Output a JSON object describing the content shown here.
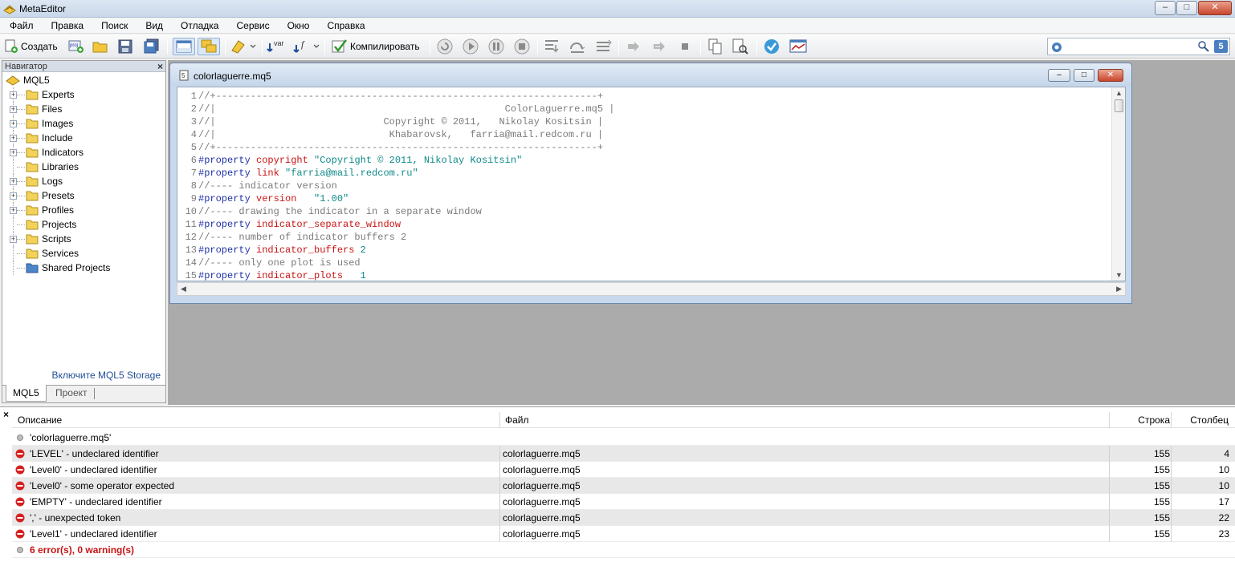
{
  "window": {
    "title": "MetaEditor",
    "min_icon": "minimize-icon",
    "max_icon": "maximize-icon",
    "close_icon": "close-icon"
  },
  "menu": [
    "Файл",
    "Правка",
    "Поиск",
    "Вид",
    "Отладка",
    "Сервис",
    "Окно",
    "Справка"
  ],
  "toolbar": {
    "create_label": "Создать",
    "compile_label": "Компилировать",
    "var_label": "var",
    "func_label": "f",
    "search_placeholder": "",
    "search_badge": "5"
  },
  "navigator": {
    "header": "Навигатор",
    "root": "MQL5",
    "items": [
      {
        "label": "Experts",
        "expandable": true
      },
      {
        "label": "Files",
        "expandable": true
      },
      {
        "label": "Images",
        "expandable": true
      },
      {
        "label": "Include",
        "expandable": true
      },
      {
        "label": "Indicators",
        "expandable": true
      },
      {
        "label": "Libraries",
        "expandable": false
      },
      {
        "label": "Logs",
        "expandable": true
      },
      {
        "label": "Presets",
        "expandable": true
      },
      {
        "label": "Profiles",
        "expandable": true
      },
      {
        "label": "Projects",
        "expandable": false
      },
      {
        "label": "Scripts",
        "expandable": true
      },
      {
        "label": "Services",
        "expandable": false
      },
      {
        "label": "Shared Projects",
        "expandable": false
      }
    ],
    "storage_link": "Включите MQL5 Storage",
    "tabs": [
      "MQL5",
      "Проект"
    ]
  },
  "editor": {
    "file_title": "colorlaguerre.mq5",
    "lines": [
      [
        [
          "c-cm",
          "//+------------------------------------------------------------------+"
        ]
      ],
      [
        [
          "c-cm",
          "//|                                                  ColorLaguerre.mq5 |"
        ]
      ],
      [
        [
          "c-cm",
          "//|                             Copyright © 2011,   Nikolay Kositsin |"
        ]
      ],
      [
        [
          "c-cm",
          "//|                              Khabarovsk,   farria@mail.redcom.ru |"
        ]
      ],
      [
        [
          "c-cm",
          "//+------------------------------------------------------------------+"
        ]
      ],
      [
        [
          "c-pp",
          "#property "
        ],
        [
          "c-kw",
          "copyright "
        ],
        [
          "c-str",
          "\"Copyright © 2011, Nikolay Kositsin\""
        ]
      ],
      [
        [
          "c-pp",
          "#property "
        ],
        [
          "c-kw",
          "link "
        ],
        [
          "c-str",
          "\"farria@mail.redcom.ru\""
        ]
      ],
      [
        [
          "c-cm",
          "//---- indicator version"
        ]
      ],
      [
        [
          "c-pp",
          "#property "
        ],
        [
          "c-kw",
          "version   "
        ],
        [
          "c-str",
          "\"1.00\""
        ]
      ],
      [
        [
          "c-cm",
          "//---- drawing the indicator in a separate window"
        ]
      ],
      [
        [
          "c-pp",
          "#property "
        ],
        [
          "c-kw",
          "indicator_separate_window"
        ]
      ],
      [
        [
          "c-cm",
          "//---- number of indicator buffers 2"
        ]
      ],
      [
        [
          "c-pp",
          "#property "
        ],
        [
          "c-kw",
          "indicator_buffers "
        ],
        [
          "c-num",
          "2"
        ]
      ],
      [
        [
          "c-cm",
          "//---- only one plot is used"
        ]
      ],
      [
        [
          "c-pp",
          "#property "
        ],
        [
          "c-kw",
          "indicator_plots   "
        ],
        [
          "c-num",
          "1"
        ]
      ],
      [
        [
          "c-cm",
          "//"
        ]
      ]
    ]
  },
  "errors": {
    "columns": {
      "description": "Описание",
      "file": "Файл",
      "line": "Строка",
      "column": "Столбец"
    },
    "header_row": "'colorlaguerre.mq5'",
    "rows": [
      {
        "description": "'LEVEL' - undeclared identifier",
        "file": "colorlaguerre.mq5",
        "line": "155",
        "column": "4"
      },
      {
        "description": "'Level0' - undeclared identifier",
        "file": "colorlaguerre.mq5",
        "line": "155",
        "column": "10"
      },
      {
        "description": "'Level0' - some operator expected",
        "file": "colorlaguerre.mq5",
        "line": "155",
        "column": "10"
      },
      {
        "description": "'EMPTY' - undeclared identifier",
        "file": "colorlaguerre.mq5",
        "line": "155",
        "column": "17"
      },
      {
        "description": "',' - unexpected token",
        "file": "colorlaguerre.mq5",
        "line": "155",
        "column": "22"
      },
      {
        "description": "'Level1' - undeclared identifier",
        "file": "colorlaguerre.mq5",
        "line": "155",
        "column": "23"
      }
    ],
    "summary": "6 error(s), 0 warning(s)"
  }
}
